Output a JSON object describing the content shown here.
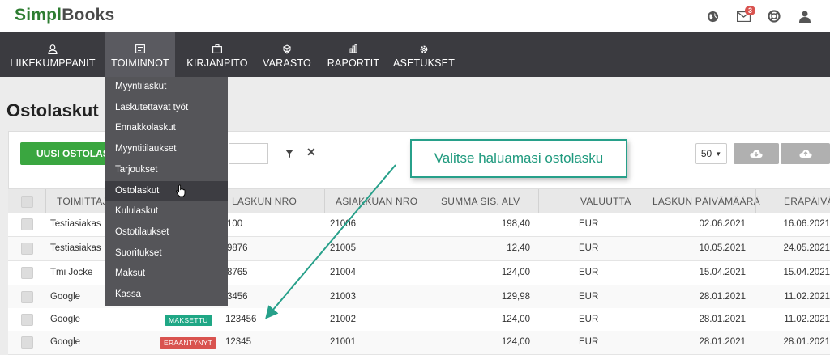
{
  "app": {
    "logo_main": "Simpl",
    "logo_sub": "Books",
    "notif_count": "3"
  },
  "nav": [
    {
      "label": "LIIKEKUMPPANIT",
      "icon": "user-icon"
    },
    {
      "label": "TOIMINNOT",
      "icon": "list-icon",
      "active": true
    },
    {
      "label": "KIRJANPITO",
      "icon": "briefcase-icon"
    },
    {
      "label": "VARASTO",
      "icon": "boxes-icon"
    },
    {
      "label": "RAPORTIT",
      "icon": "bar-chart-icon"
    },
    {
      "label": "ASETUKSET",
      "icon": "gear-icon"
    }
  ],
  "page_title": "Ostolaskut",
  "toolbar": {
    "new_button": "UUSI OSTOLASKU",
    "per_page": "50"
  },
  "dropdown": [
    "Myyntilaskut",
    "Laskutettavat työt",
    "Ennakkolaskut",
    "Myyntitilaukset",
    "Tarjoukset",
    "Ostolaskut",
    "Kululaskut",
    "Ostotilaukset",
    "Suoritukset",
    "Maksut",
    "Kassa"
  ],
  "dropdown_active": 5,
  "table": {
    "headers": [
      "TOIMITTAJA",
      "LASKUN NRO",
      "ASIAKKUAN NRO",
      "SUMMA SIS. ALV",
      "VALUUTTA",
      "LASKUN PÄIVÄMÄÄRÄ",
      "ERÄPÄIVÄ"
    ],
    "rows": [
      {
        "supplier": "Testiasiakas",
        "status": "",
        "invoice": "100",
        "customer": "21006",
        "sum": "198,40",
        "currency": "EUR",
        "date": "02.06.2021",
        "due": "16.06.2021"
      },
      {
        "supplier": "Testiasiakas",
        "status": "",
        "invoice": "9876",
        "customer": "21005",
        "sum": "12,40",
        "currency": "EUR",
        "date": "10.05.2021",
        "due": "24.05.2021"
      },
      {
        "supplier": "Tmi Jocke",
        "status": "",
        "invoice": "8765",
        "customer": "21004",
        "sum": "124,00",
        "currency": "EUR",
        "date": "15.04.2021",
        "due": "15.04.2021"
      },
      {
        "supplier": "Google",
        "status": "",
        "invoice": "3456",
        "customer": "21003",
        "sum": "129,98",
        "currency": "EUR",
        "date": "28.01.2021",
        "due": "11.02.2021"
      },
      {
        "supplier": "Google",
        "status": "MAKSETTU",
        "invoice": "123456",
        "customer": "21002",
        "sum": "124,00",
        "currency": "EUR",
        "date": "28.01.2021",
        "due": "11.02.2021"
      },
      {
        "supplier": "Google",
        "status": "ERÄÄNTYNYT",
        "invoice": "12345",
        "customer": "21001",
        "sum": "124,00",
        "currency": "EUR",
        "date": "28.01.2021",
        "due": "28.01.2021"
      }
    ]
  },
  "status_colors": {
    "MAKSETTU": "#1fa785",
    "ERÄÄNTYNYT": "#d9534f"
  },
  "callout": "Valitse haluamasi ostolasku"
}
